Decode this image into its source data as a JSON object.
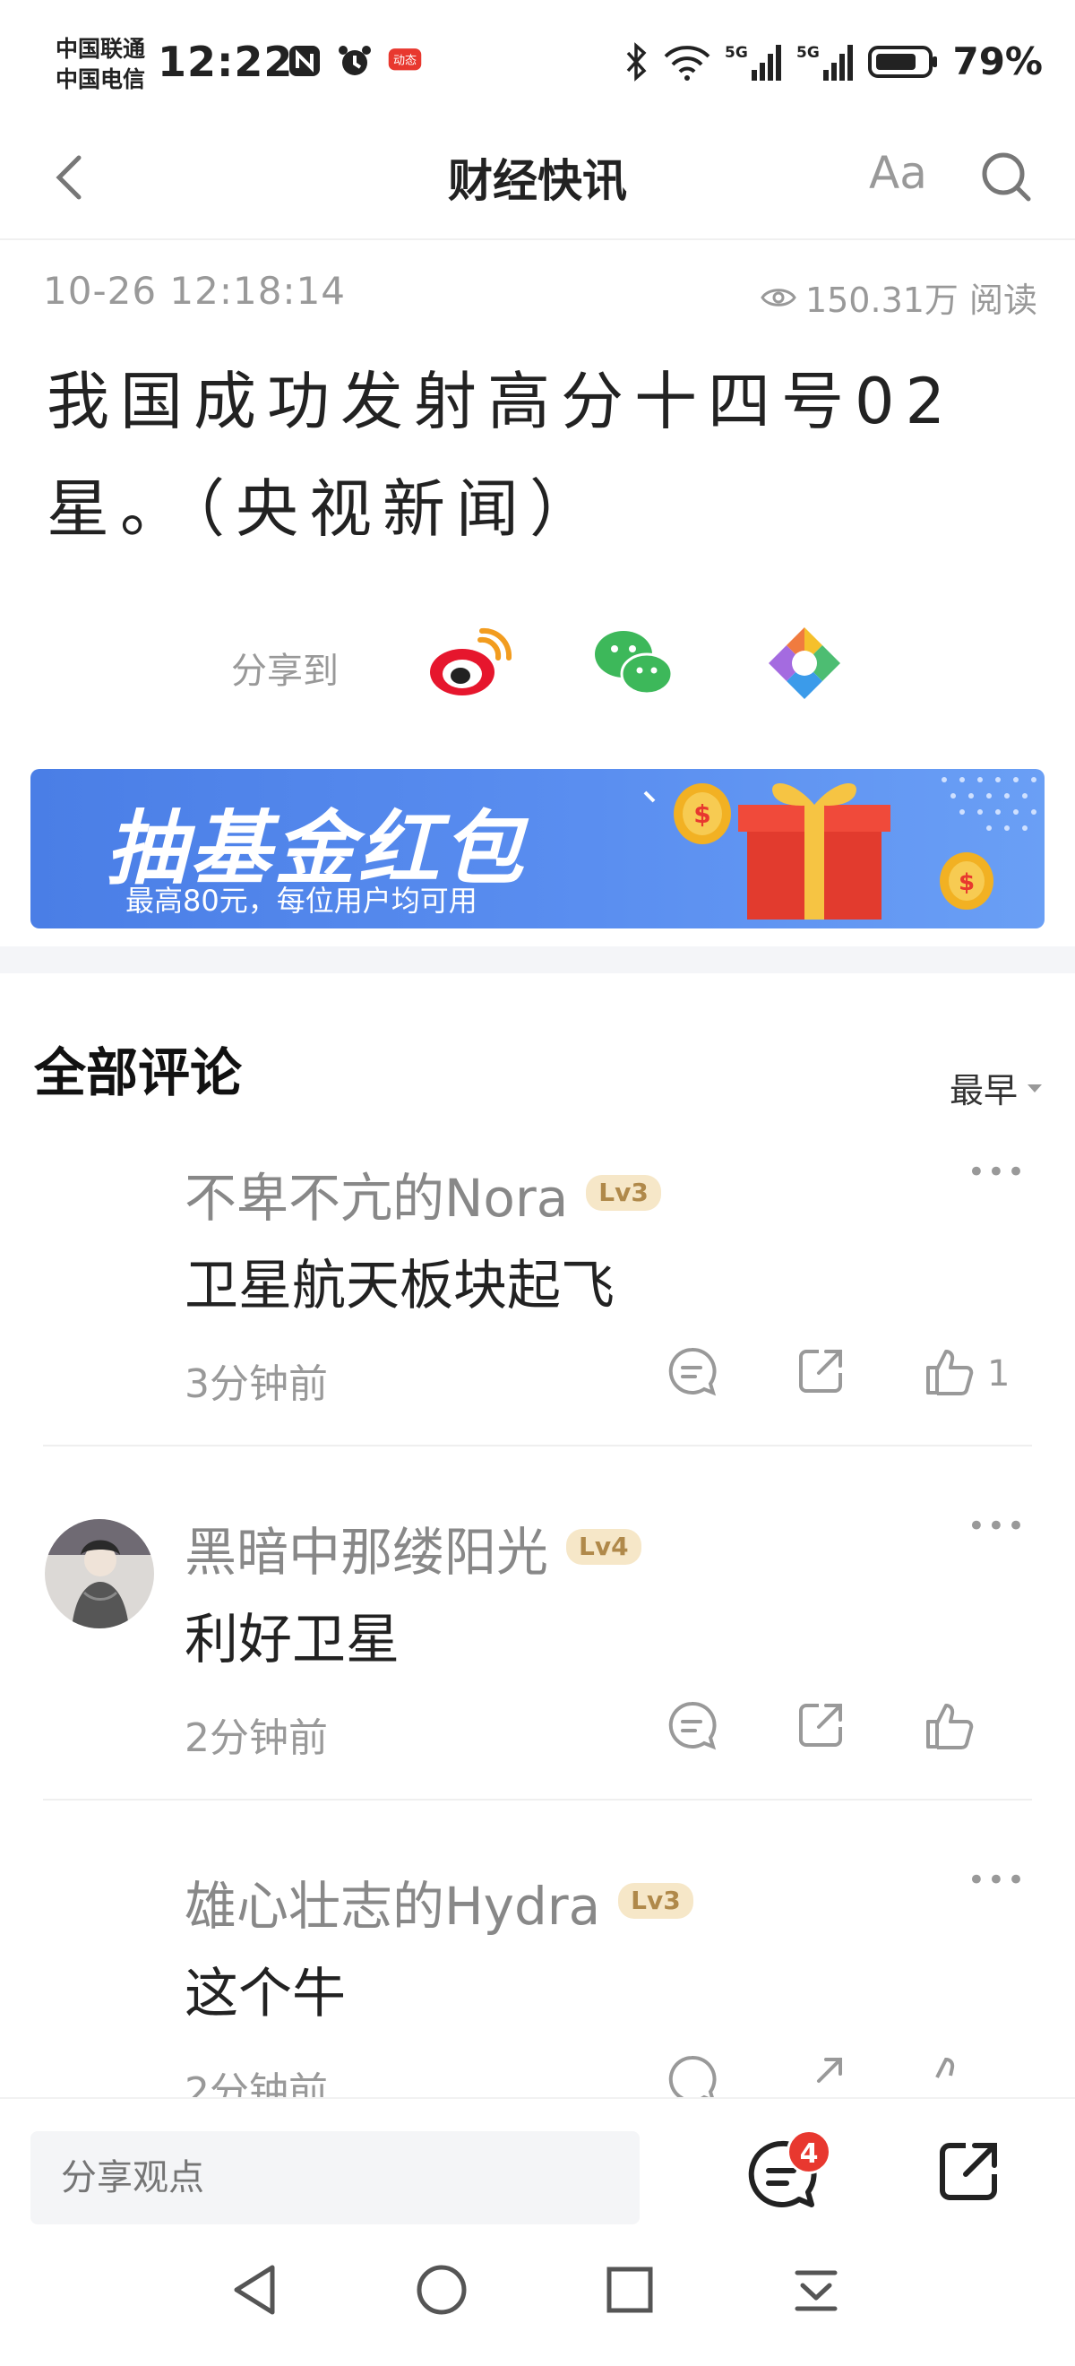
{
  "status_bar": {
    "carrier_1": "中国联通",
    "carrier_2": "中国电信",
    "time": "12:22",
    "battery": "79%",
    "net_1": "5G",
    "net_2": "5G",
    "app_badge": "动态",
    "icons": [
      "nfc-icon",
      "alarm-icon",
      "app-notification-icon",
      "bluetooth-icon",
      "wifi-icon",
      "signal-icon",
      "battery-icon"
    ]
  },
  "nav": {
    "title": "财经快讯",
    "font_label": "Aa"
  },
  "article": {
    "datetime": "10-26 12:18:14",
    "reads": "150.31万 阅读",
    "headline": "我国成功发射高分十四号02星。（央视新闻）"
  },
  "share": {
    "label": "分享到",
    "targets": [
      "weibo-icon",
      "wechat-icon",
      "moments-icon"
    ]
  },
  "banner": {
    "title": "抽基金红包",
    "subtitle": "最高80元，每位用户均可用"
  },
  "comments": {
    "heading": "全部评论",
    "sort_label": "最早",
    "items": [
      {
        "user": "不卑不亢的Nora",
        "level": "Lv3",
        "text": "卫星航天板块起飞",
        "time": "3分钟前",
        "likes": "1",
        "has_avatar": false
      },
      {
        "user": "黑暗中那缕阳光",
        "level": "Lv4",
        "text": "利好卫星",
        "time": "2分钟前",
        "likes": "",
        "has_avatar": true
      },
      {
        "user": "雄心壮志的Hydra",
        "level": "Lv3",
        "text": "这个牛",
        "time": "2分钟前",
        "likes": "",
        "has_avatar": false
      }
    ]
  },
  "bottom_bar": {
    "input_placeholder": "分享观点",
    "comment_count": "4"
  },
  "colors": {
    "accent_red": "#e8382f",
    "banner_blue": "#5a8ef0",
    "muted_text": "#999999",
    "level_badge": "#f6e7c8"
  }
}
